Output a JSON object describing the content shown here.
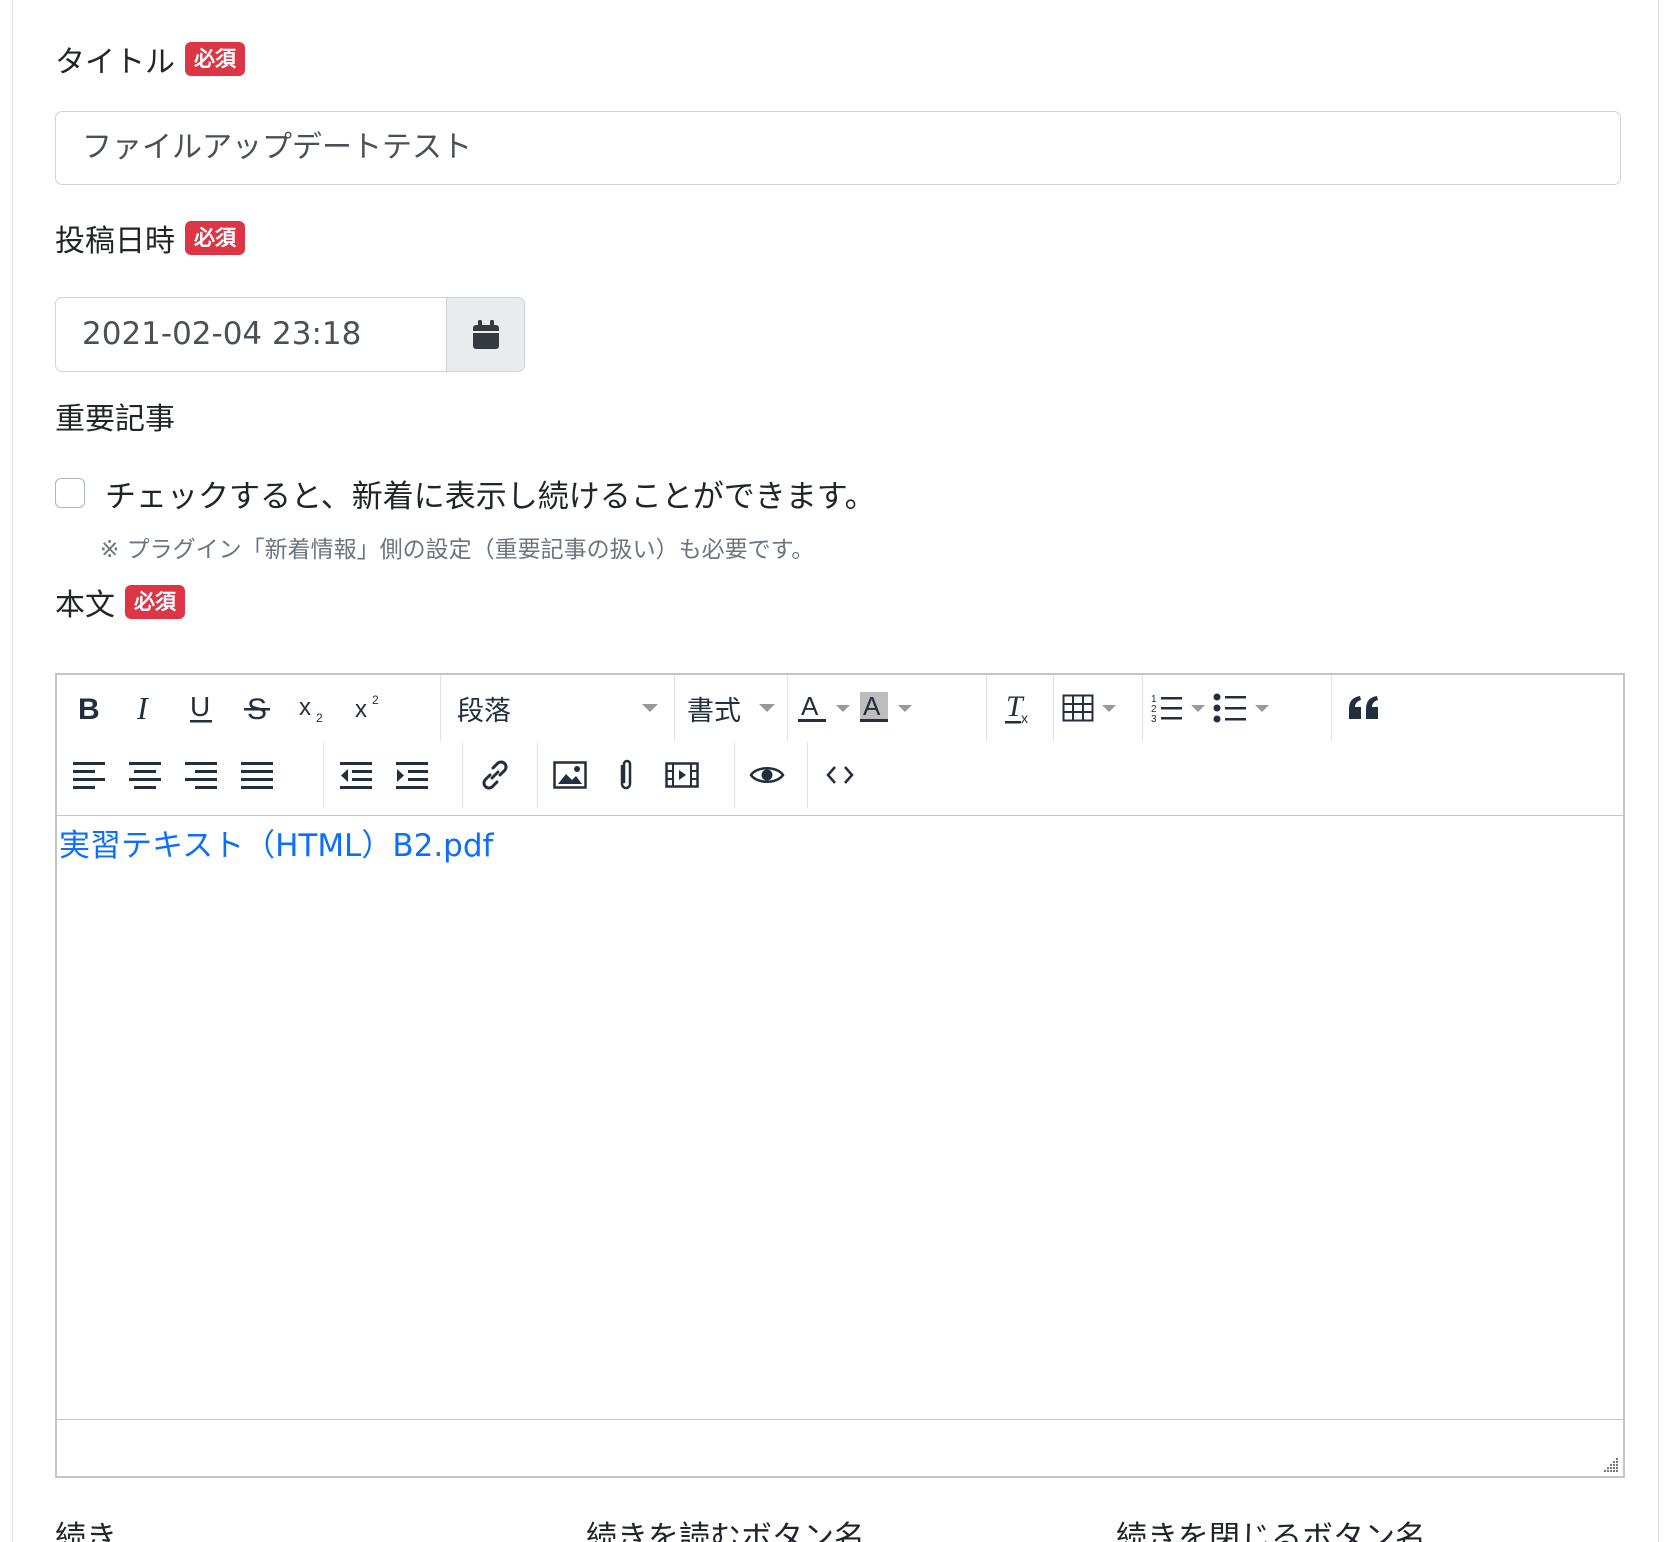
{
  "title_field": {
    "label": "タイトル",
    "badge": "必須",
    "value": "ファイルアップデートテスト"
  },
  "date_field": {
    "label": "投稿日時",
    "badge": "必須",
    "value": "2021-02-04 23:18",
    "button_icon": "calendar-icon"
  },
  "important_field": {
    "label": "重要記事",
    "checkbox_label": "チェックすると、新着に表示し続けることができます。",
    "checked": false,
    "note": "※ プラグイン「新着情報」側の設定（重要記事の扱い）も必要です。"
  },
  "body_field": {
    "label": "本文",
    "badge": "必須",
    "toolbar": {
      "block_select": "段落",
      "format_menu": "書式",
      "buttons_row1": [
        "bold-icon",
        "italic-icon",
        "underline-icon",
        "strikethrough-icon",
        "subscript-icon",
        "superscript-icon",
        "text-color-icon",
        "background-color-icon",
        "clear-formatting-icon",
        "table-icon",
        "numbered-list-icon",
        "bullet-list-icon",
        "blockquote-icon"
      ],
      "buttons_row2": [
        "align-left-icon",
        "align-center-icon",
        "align-right-icon",
        "align-justify-icon",
        "outdent-icon",
        "indent-icon",
        "link-icon",
        "image-icon",
        "attachment-icon",
        "media-icon",
        "preview-icon",
        "source-code-icon"
      ]
    },
    "content_link_text": "実習テキスト（HTML）B2.pdf"
  },
  "bottom_labels": {
    "continue": "続き",
    "read_more_button_name": "続きを読むボタン名",
    "close_button_name": "続きを閉じるボタン名"
  },
  "colors": {
    "badge": "#dc3545",
    "link": "#0d6efd",
    "border": "#ced4da"
  }
}
